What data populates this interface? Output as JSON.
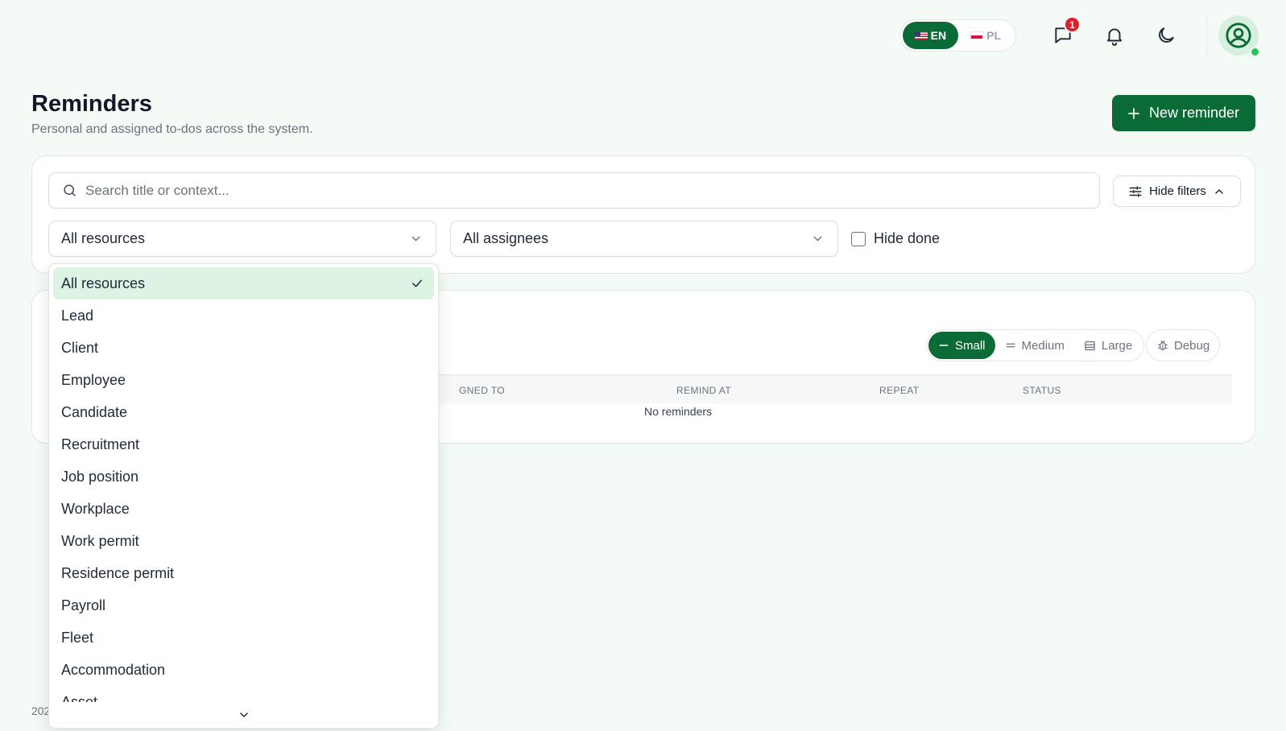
{
  "topbar": {
    "languages": [
      {
        "code": "EN",
        "active": true,
        "flag": "us-flag-icon"
      },
      {
        "code": "PL",
        "active": false,
        "flag": "pl-flag-icon"
      }
    ],
    "messages_badge": "1",
    "icons": [
      "chat-icon",
      "bell-icon",
      "moon-icon",
      "user-avatar-icon"
    ]
  },
  "header": {
    "title": "Reminders",
    "subtitle": "Personal and assigned to-dos across the system.",
    "new_button_label": "New reminder"
  },
  "filters": {
    "search_placeholder": "Search title or context...",
    "hide_filters_label": "Hide filters",
    "resource_select_value": "All resources",
    "assignee_select_value": "All assignees",
    "hide_done_label": "Hide done",
    "hide_done_checked": false
  },
  "table": {
    "density_options": [
      {
        "label": "Small",
        "active": true
      },
      {
        "label": "Medium",
        "active": false
      },
      {
        "label": "Large",
        "active": false
      }
    ],
    "debug_label": "Debug",
    "columns": [
      "GNED TO",
      "REMIND AT",
      "REPEAT",
      "STATUS"
    ],
    "empty_text": "No reminders"
  },
  "footer": {
    "text": "202"
  },
  "dropdown": {
    "selected": "All resources",
    "options": [
      "All resources",
      "Lead",
      "Client",
      "Employee",
      "Candidate",
      "Recruitment",
      "Job position",
      "Workplace",
      "Work permit",
      "Residence permit",
      "Payroll",
      "Fleet",
      "Accommodation",
      "Asset"
    ]
  },
  "colors": {
    "brand": "#0b6b36",
    "badge": "#e11d2a",
    "selected_bg": "#ddf3e3",
    "page_bg": "#f4faf6"
  }
}
